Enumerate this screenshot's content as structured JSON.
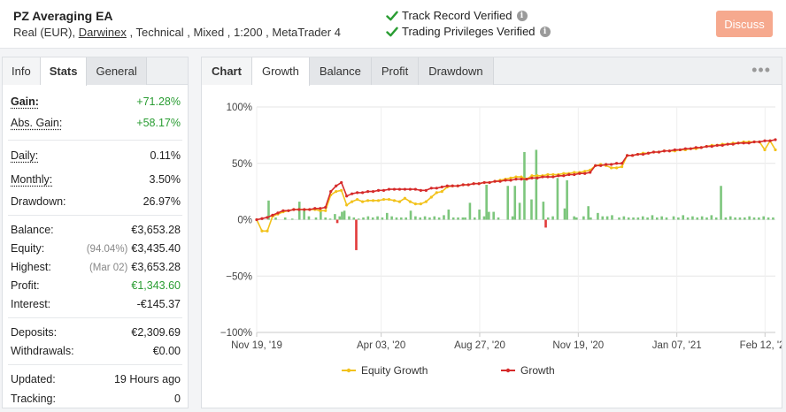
{
  "header": {
    "system_name": "PZ Averaging EA",
    "desc_prefix": "Real (EUR), ",
    "broker_link": "Darwinex",
    "desc_suffix": " , Technical , Mixed , 1:200 , MetaTrader 4",
    "verify_1": "Track Record Verified",
    "verify_2": "Trading Privileges Verified",
    "discuss_label": "Discuss",
    "discuss_color": "#f6a98e",
    "check_color": "#2a9d33"
  },
  "left_tabs": [
    "Info",
    "Stats",
    "General"
  ],
  "stats": {
    "gain": {
      "label": "Gain:",
      "value": "+71.28%"
    },
    "abs_gain": {
      "label": "Abs. Gain:",
      "value": "+58.17%"
    },
    "daily": {
      "label": "Daily:",
      "value": "0.11%"
    },
    "monthly": {
      "label": "Monthly:",
      "value": "3.50%"
    },
    "drawdown": {
      "label": "Drawdown:",
      "value": "26.97%"
    },
    "balance": {
      "label": "Balance:",
      "value": "€3,653.28"
    },
    "equity": {
      "label": "Equity:",
      "note": "(94.04%)",
      "value": "€3,435.40"
    },
    "highest": {
      "label": "Highest:",
      "note": "(Mar 02)",
      "value": "€3,653.28"
    },
    "profit": {
      "label": "Profit:",
      "value": "€1,343.60"
    },
    "interest": {
      "label": "Interest:",
      "value": "-€145.37"
    },
    "deposits": {
      "label": "Deposits:",
      "value": "€2,309.69"
    },
    "withdrawals": {
      "label": "Withdrawals:",
      "value": "€0.00"
    },
    "updated": {
      "label": "Updated:",
      "value": "19 Hours ago"
    },
    "tracking": {
      "label": "Tracking:",
      "value": "0"
    }
  },
  "chart_tabs": {
    "label": "Chart",
    "tabs": [
      "Growth",
      "Balance",
      "Profit",
      "Drawdown"
    ],
    "active": "Growth",
    "more_icon": "•••"
  },
  "chart_data": {
    "type": "line",
    "x_tick_labels": [
      "Nov 19, '19",
      "Apr 03, '20",
      "Aug 27, '20",
      "Nov 19, '20",
      "Jan 07, '21",
      "Feb 12, '21"
    ],
    "y_ticks": [
      "100%",
      "50%",
      "0%",
      "−50%",
      "−100%"
    ],
    "ylim": [
      -100,
      100
    ],
    "grid": true,
    "legend_position": "bottom",
    "colors": {
      "equity": "#f2c21b",
      "growth": "#d62a2a",
      "bars_pos": "#7dc67d",
      "bars_neg": "#e23b3b",
      "grid": "#e6e6e6"
    },
    "series": [
      {
        "name": "Equity Growth",
        "values": [
          0,
          -10,
          -10,
          3,
          5,
          7,
          8,
          9,
          9,
          9,
          9,
          9,
          8,
          8,
          22,
          25,
          26,
          13,
          16,
          18,
          16,
          17,
          17,
          17,
          18,
          18,
          17,
          16,
          19,
          16,
          14,
          14,
          16,
          20,
          24,
          25,
          29,
          30,
          30,
          31,
          31,
          32,
          32,
          33,
          33,
          34,
          35,
          36,
          37,
          38,
          38,
          36,
          39,
          39,
          39,
          40,
          40,
          40,
          41,
          41,
          42,
          42,
          43,
          44,
          48,
          49,
          48,
          46,
          46,
          47,
          57,
          57,
          58,
          59,
          59,
          60,
          60,
          61,
          61,
          61,
          62,
          62,
          63,
          63,
          64,
          65,
          66,
          66,
          67,
          67,
          68,
          68,
          69,
          69,
          69,
          69,
          62,
          70,
          62
        ]
      },
      {
        "name": "Growth",
        "values": [
          0,
          1,
          2,
          4,
          6,
          8,
          8,
          9,
          9,
          9,
          9,
          10,
          10,
          11,
          25,
          30,
          33,
          21,
          23,
          24,
          24,
          25,
          25,
          26,
          26,
          27,
          27,
          27,
          27,
          27,
          27,
          26,
          26,
          28,
          28,
          29,
          30,
          30,
          30,
          31,
          31,
          32,
          32,
          33,
          33,
          34,
          34,
          35,
          35,
          36,
          36,
          36,
          37,
          37,
          38,
          38,
          38,
          39,
          39,
          40,
          40,
          41,
          41,
          42,
          48,
          48,
          49,
          49,
          50,
          50,
          57,
          57,
          58,
          58,
          59,
          60,
          60,
          61,
          61,
          62,
          62,
          63,
          63,
          64,
          64,
          65,
          65,
          66,
          66,
          67,
          67,
          68,
          68,
          68,
          69,
          69,
          70,
          70,
          71
        ]
      }
    ],
    "bars": [
      {
        "x": 5,
        "v": 17
      },
      {
        "x": 8,
        "v": 2
      },
      {
        "x": 12,
        "v": 2
      },
      {
        "x": 15,
        "v": 1
      },
      {
        "x": 18,
        "v": 16
      },
      {
        "x": 20,
        "v": 8
      },
      {
        "x": 22,
        "v": 3
      },
      {
        "x": 25,
        "v": 2
      },
      {
        "x": 27,
        "v": 9
      },
      {
        "x": 29,
        "v": 2
      },
      {
        "x": 31,
        "v": 1
      },
      {
        "x": 33,
        "v": 5
      },
      {
        "x": 35,
        "v": 3
      },
      {
        "x": 36,
        "v": 7
      },
      {
        "x": 37,
        "v": 8
      },
      {
        "x": 39,
        "v": 3
      },
      {
        "x": 41,
        "v": 2
      },
      {
        "x": 43,
        "v": 1
      },
      {
        "x": 45,
        "v": 2
      },
      {
        "x": 47,
        "v": 3
      },
      {
        "x": 49,
        "v": 2
      },
      {
        "x": 51,
        "v": 3
      },
      {
        "x": 53,
        "v": 2
      },
      {
        "x": 55,
        "v": 6
      },
      {
        "x": 57,
        "v": 3
      },
      {
        "x": 59,
        "v": 2
      },
      {
        "x": 61,
        "v": 2
      },
      {
        "x": 63,
        "v": 2
      },
      {
        "x": 65,
        "v": 8
      },
      {
        "x": 67,
        "v": 3
      },
      {
        "x": 69,
        "v": 2
      },
      {
        "x": 71,
        "v": 3
      },
      {
        "x": 73,
        "v": 2
      },
      {
        "x": 75,
        "v": 3
      },
      {
        "x": 77,
        "v": 2
      },
      {
        "x": 79,
        "v": 4
      },
      {
        "x": 81,
        "v": 9
      },
      {
        "x": 83,
        "v": 2
      },
      {
        "x": 85,
        "v": 2
      },
      {
        "x": 87,
        "v": 2
      },
      {
        "x": 88,
        "v": 2
      },
      {
        "x": 90,
        "v": 15
      },
      {
        "x": 92,
        "v": 2
      },
      {
        "x": 94,
        "v": 9
      },
      {
        "x": 96,
        "v": 3
      },
      {
        "x": 97,
        "v": 31
      },
      {
        "x": 98,
        "v": 7
      },
      {
        "x": 100,
        "v": 7
      },
      {
        "x": 102,
        "v": 2
      },
      {
        "x": 106,
        "v": 30
      },
      {
        "x": 108,
        "v": 3
      },
      {
        "x": 109,
        "v": 30
      },
      {
        "x": 111,
        "v": 15
      },
      {
        "x": 113,
        "v": 60
      },
      {
        "x": 116,
        "v": 18
      },
      {
        "x": 118,
        "v": 62
      },
      {
        "x": 121,
        "v": 16
      },
      {
        "x": 123,
        "v": 2
      },
      {
        "x": 125,
        "v": 3
      },
      {
        "x": 127,
        "v": 37
      },
      {
        "x": 130,
        "v": 10
      },
      {
        "x": 131,
        "v": 35
      },
      {
        "x": 134,
        "v": 3
      },
      {
        "x": 135,
        "v": 2
      },
      {
        "x": 138,
        "v": 3
      },
      {
        "x": 140,
        "v": 12
      },
      {
        "x": 141,
        "v": 2
      },
      {
        "x": 144,
        "v": 6
      },
      {
        "x": 146,
        "v": 3
      },
      {
        "x": 148,
        "v": 3
      },
      {
        "x": 150,
        "v": 4
      },
      {
        "x": 153,
        "v": 2
      },
      {
        "x": 155,
        "v": 3
      },
      {
        "x": 157,
        "v": 2
      },
      {
        "x": 159,
        "v": 2
      },
      {
        "x": 161,
        "v": 2
      },
      {
        "x": 163,
        "v": 3
      },
      {
        "x": 165,
        "v": 2
      },
      {
        "x": 167,
        "v": 4
      },
      {
        "x": 169,
        "v": 2
      },
      {
        "x": 171,
        "v": 3
      },
      {
        "x": 173,
        "v": 2
      },
      {
        "x": 176,
        "v": 3
      },
      {
        "x": 178,
        "v": 2
      },
      {
        "x": 180,
        "v": 4
      },
      {
        "x": 182,
        "v": 2
      },
      {
        "x": 184,
        "v": 3
      },
      {
        "x": 186,
        "v": 2
      },
      {
        "x": 188,
        "v": 3
      },
      {
        "x": 190,
        "v": 2
      },
      {
        "x": 192,
        "v": 4
      },
      {
        "x": 194,
        "v": 2
      },
      {
        "x": 196,
        "v": 30
      },
      {
        "x": 198,
        "v": 2
      },
      {
        "x": 200,
        "v": 3
      },
      {
        "x": 202,
        "v": 2
      },
      {
        "x": 204,
        "v": 2
      },
      {
        "x": 206,
        "v": 2
      },
      {
        "x": 208,
        "v": 3
      },
      {
        "x": 210,
        "v": 2
      },
      {
        "x": 212,
        "v": 2
      },
      {
        "x": 214,
        "v": 3
      },
      {
        "x": 216,
        "v": 2
      },
      {
        "x": 218,
        "v": 2
      }
    ]
  }
}
